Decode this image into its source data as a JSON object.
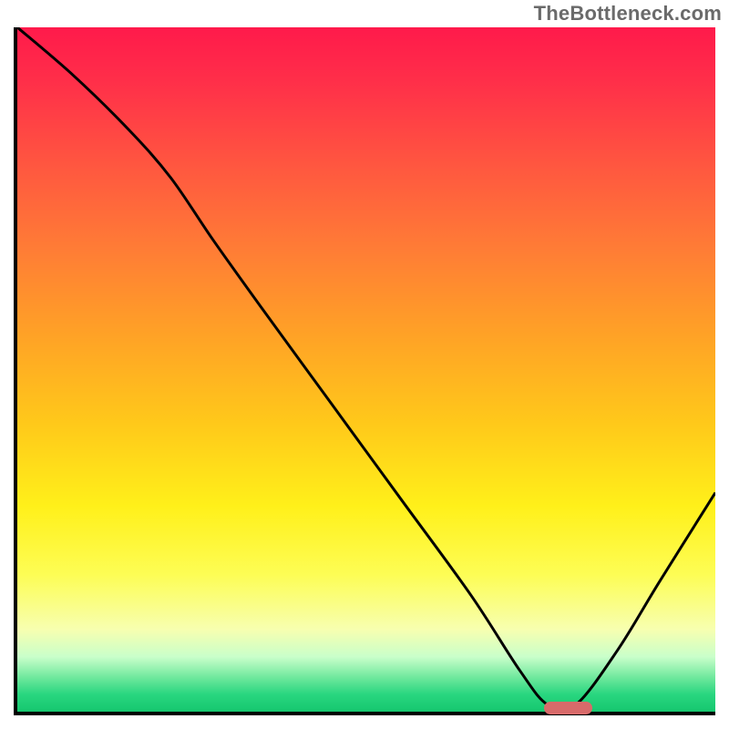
{
  "watermark": "TheBottleneck.com",
  "colors": {
    "curve": "#000000",
    "marker": "#d86a6a",
    "axis": "#000000"
  },
  "chart_data": {
    "type": "line",
    "title": "",
    "xlabel": "",
    "ylabel": "",
    "xlim": [
      0,
      100
    ],
    "ylim": [
      0,
      100
    ],
    "grid": false,
    "series": [
      {
        "name": "bottleneck-curve",
        "x": [
          0,
          8,
          16,
          22,
          28,
          35,
          45,
          55,
          65,
          72,
          76,
          80,
          86,
          92,
          100
        ],
        "values": [
          100,
          93,
          85,
          78,
          69,
          59,
          45,
          31,
          17,
          6,
          1,
          1,
          9,
          19,
          32
        ]
      }
    ],
    "annotations": [
      {
        "name": "optimal-marker",
        "type": "hbar",
        "x_start": 75,
        "x_end": 82,
        "y": 1
      }
    ]
  }
}
